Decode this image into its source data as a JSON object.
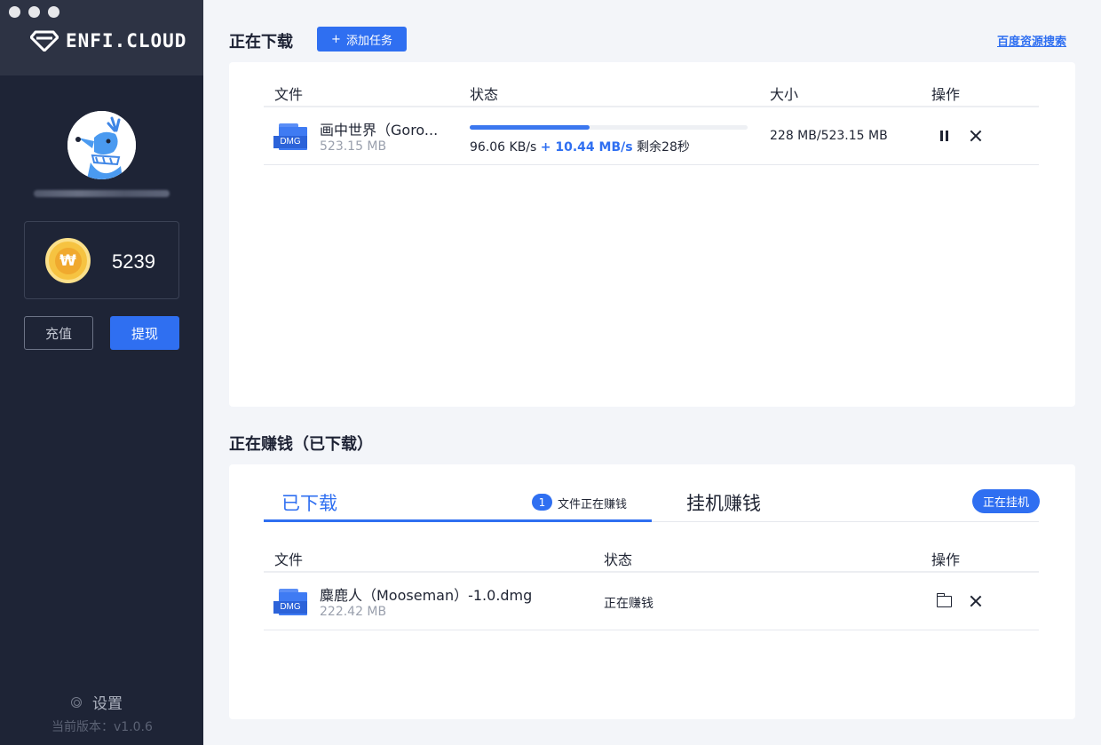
{
  "app": {
    "logo_text": "ENFI.CLOUD",
    "coins": "5239",
    "recharge_label": "充值",
    "withdraw_label": "提现",
    "settings_label": "设置",
    "version": "当前版本：v1.0.6"
  },
  "downloading": {
    "title": "正在下载",
    "add_task_label": "添加任务",
    "baidu_link": "百度资源搜索",
    "columns": [
      "文件",
      "状态",
      "大小",
      "操作"
    ],
    "rows": [
      {
        "icon_label": "DMG",
        "name": "画中世界（Goro...",
        "size": "523.15 MB",
        "progress": 0.43,
        "speed": "96.06 KB/s",
        "boost": "+ 10.44 MB/s",
        "remaining": "剩余28秒",
        "size_progress": "228 MB/523.15 MB"
      }
    ]
  },
  "earning": {
    "title": "正在赚钱（已下载）",
    "tab_downloaded": "已下载",
    "badge_count": "1",
    "badge_text": "文件正在赚钱",
    "tab_mining": "挂机赚钱",
    "pill_label": "正在挂机",
    "columns": [
      "文件",
      "状态",
      "操作"
    ],
    "rows": [
      {
        "icon_label": "DMG",
        "name": "麋鹿人（Mooseman）-1.0.dmg",
        "size": "222.42 MB",
        "status": "正在赚钱"
      }
    ]
  },
  "colors": {
    "accent": "#2f6ff1",
    "sidebar": "#1e2436",
    "coin": "#f6c341"
  }
}
